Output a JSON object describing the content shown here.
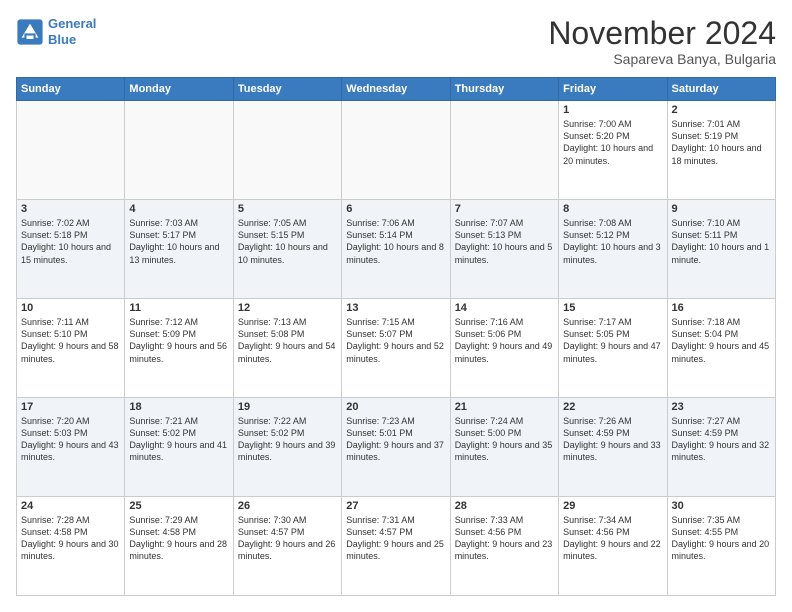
{
  "header": {
    "logo_line1": "General",
    "logo_line2": "Blue",
    "month": "November 2024",
    "location": "Sapareva Banya, Bulgaria"
  },
  "weekdays": [
    "Sunday",
    "Monday",
    "Tuesday",
    "Wednesday",
    "Thursday",
    "Friday",
    "Saturday"
  ],
  "weeks": [
    [
      {
        "day": "",
        "info": ""
      },
      {
        "day": "",
        "info": ""
      },
      {
        "day": "",
        "info": ""
      },
      {
        "day": "",
        "info": ""
      },
      {
        "day": "",
        "info": ""
      },
      {
        "day": "1",
        "info": "Sunrise: 7:00 AM\nSunset: 5:20 PM\nDaylight: 10 hours\nand 20 minutes."
      },
      {
        "day": "2",
        "info": "Sunrise: 7:01 AM\nSunset: 5:19 PM\nDaylight: 10 hours\nand 18 minutes."
      }
    ],
    [
      {
        "day": "3",
        "info": "Sunrise: 7:02 AM\nSunset: 5:18 PM\nDaylight: 10 hours\nand 15 minutes."
      },
      {
        "day": "4",
        "info": "Sunrise: 7:03 AM\nSunset: 5:17 PM\nDaylight: 10 hours\nand 13 minutes."
      },
      {
        "day": "5",
        "info": "Sunrise: 7:05 AM\nSunset: 5:15 PM\nDaylight: 10 hours\nand 10 minutes."
      },
      {
        "day": "6",
        "info": "Sunrise: 7:06 AM\nSunset: 5:14 PM\nDaylight: 10 hours\nand 8 minutes."
      },
      {
        "day": "7",
        "info": "Sunrise: 7:07 AM\nSunset: 5:13 PM\nDaylight: 10 hours\nand 5 minutes."
      },
      {
        "day": "8",
        "info": "Sunrise: 7:08 AM\nSunset: 5:12 PM\nDaylight: 10 hours\nand 3 minutes."
      },
      {
        "day": "9",
        "info": "Sunrise: 7:10 AM\nSunset: 5:11 PM\nDaylight: 10 hours\nand 1 minute."
      }
    ],
    [
      {
        "day": "10",
        "info": "Sunrise: 7:11 AM\nSunset: 5:10 PM\nDaylight: 9 hours\nand 58 minutes."
      },
      {
        "day": "11",
        "info": "Sunrise: 7:12 AM\nSunset: 5:09 PM\nDaylight: 9 hours\nand 56 minutes."
      },
      {
        "day": "12",
        "info": "Sunrise: 7:13 AM\nSunset: 5:08 PM\nDaylight: 9 hours\nand 54 minutes."
      },
      {
        "day": "13",
        "info": "Sunrise: 7:15 AM\nSunset: 5:07 PM\nDaylight: 9 hours\nand 52 minutes."
      },
      {
        "day": "14",
        "info": "Sunrise: 7:16 AM\nSunset: 5:06 PM\nDaylight: 9 hours\nand 49 minutes."
      },
      {
        "day": "15",
        "info": "Sunrise: 7:17 AM\nSunset: 5:05 PM\nDaylight: 9 hours\nand 47 minutes."
      },
      {
        "day": "16",
        "info": "Sunrise: 7:18 AM\nSunset: 5:04 PM\nDaylight: 9 hours\nand 45 minutes."
      }
    ],
    [
      {
        "day": "17",
        "info": "Sunrise: 7:20 AM\nSunset: 5:03 PM\nDaylight: 9 hours\nand 43 minutes."
      },
      {
        "day": "18",
        "info": "Sunrise: 7:21 AM\nSunset: 5:02 PM\nDaylight: 9 hours\nand 41 minutes."
      },
      {
        "day": "19",
        "info": "Sunrise: 7:22 AM\nSunset: 5:02 PM\nDaylight: 9 hours\nand 39 minutes."
      },
      {
        "day": "20",
        "info": "Sunrise: 7:23 AM\nSunset: 5:01 PM\nDaylight: 9 hours\nand 37 minutes."
      },
      {
        "day": "21",
        "info": "Sunrise: 7:24 AM\nSunset: 5:00 PM\nDaylight: 9 hours\nand 35 minutes."
      },
      {
        "day": "22",
        "info": "Sunrise: 7:26 AM\nSunset: 4:59 PM\nDaylight: 9 hours\nand 33 minutes."
      },
      {
        "day": "23",
        "info": "Sunrise: 7:27 AM\nSunset: 4:59 PM\nDaylight: 9 hours\nand 32 minutes."
      }
    ],
    [
      {
        "day": "24",
        "info": "Sunrise: 7:28 AM\nSunset: 4:58 PM\nDaylight: 9 hours\nand 30 minutes."
      },
      {
        "day": "25",
        "info": "Sunrise: 7:29 AM\nSunset: 4:58 PM\nDaylight: 9 hours\nand 28 minutes."
      },
      {
        "day": "26",
        "info": "Sunrise: 7:30 AM\nSunset: 4:57 PM\nDaylight: 9 hours\nand 26 minutes."
      },
      {
        "day": "27",
        "info": "Sunrise: 7:31 AM\nSunset: 4:57 PM\nDaylight: 9 hours\nand 25 minutes."
      },
      {
        "day": "28",
        "info": "Sunrise: 7:33 AM\nSunset: 4:56 PM\nDaylight: 9 hours\nand 23 minutes."
      },
      {
        "day": "29",
        "info": "Sunrise: 7:34 AM\nSunset: 4:56 PM\nDaylight: 9 hours\nand 22 minutes."
      },
      {
        "day": "30",
        "info": "Sunrise: 7:35 AM\nSunset: 4:55 PM\nDaylight: 9 hours\nand 20 minutes."
      }
    ]
  ]
}
